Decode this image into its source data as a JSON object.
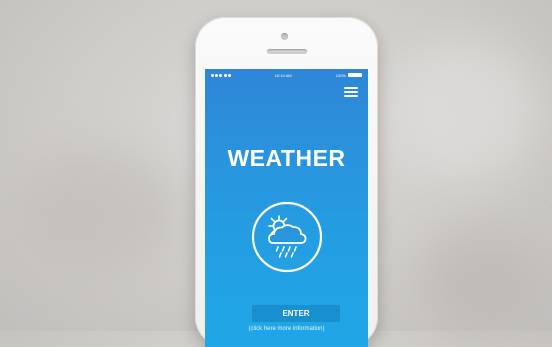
{
  "status_bar": {
    "time": "10:10 AM",
    "battery_text": "100%",
    "battery_level": 1.0,
    "signal_bars": 5
  },
  "icons": {
    "menu": "hamburger-menu-icon",
    "weather": "sun-cloud-rain-icon"
  },
  "app": {
    "title": "WEATHER",
    "enter_label": "ENTER",
    "info_text": "(click here more information)"
  },
  "colors": {
    "screen_top": "#2f86d8",
    "screen_bottom": "#1fa7e6",
    "button": "#1a8fd0",
    "phone_body": "#f5f5f5"
  }
}
